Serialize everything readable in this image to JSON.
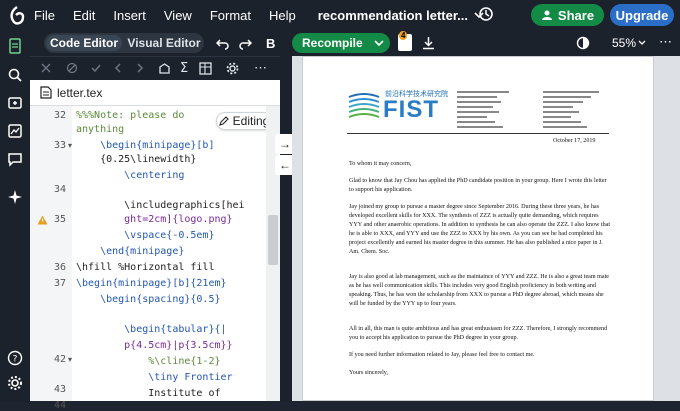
{
  "topbar": {
    "menu": [
      "File",
      "Edit",
      "Insert",
      "View",
      "Format",
      "Help"
    ],
    "title": "recommendation letter...",
    "share": "Share",
    "upgrade": "Upgrade"
  },
  "editor": {
    "code_editor": "Code Editor",
    "visual_editor": "Visual Editor",
    "file_name": "letter.tex",
    "editing": "Editing",
    "line_numbers": [
      "32",
      "",
      "33",
      "",
      "34",
      "35",
      "",
      "36",
      "37",
      "",
      "",
      "",
      "",
      "42",
      "",
      "43",
      "44"
    ],
    "lines": [
      "%%%Note: please do",
      "anything",
      "    \\begin{minipage}[b]",
      "    {0.25\\linewidth}",
      "        \\centering",
      "",
      "        \\includegraphics[hei",
      "        ght=2cm]{logo.png}",
      "        \\vspace{-0.5em}",
      "    \\end{minipage}",
      "\\hfill %Horizontal fill",
      "\\begin{minipage}[b]{21em}",
      "    \\begin{spacing}{0.5}",
      "",
      "        \\begin{tabular}{|",
      "        p{4.5cm}|p{3.5cm}}",
      "            %\\cline{1-2}",
      "            \\tiny Frontier",
      "            Institute of"
    ]
  },
  "preview": {
    "recompile": "Recompile",
    "zoom": "55%",
    "badge": "4",
    "logo_text": "FIST",
    "logo_cn": "前沿科学技术研究院",
    "date": "October 17, 2019",
    "salutation": "To whom it may concern,",
    "p1": "Glad to know that Jay Chou has applied the PhD candidate position in your group. Here I wrote this letter to support his application.",
    "p2": "Jay joined my group to pursue a master degree since September 2016. During these three years, he has developed excellent skills for XXX. The synthesis of ZZZ is actually quite demanding, which requires YYY and other anaerobic operations. In addition to synthesis he can also operate the ZZZ. I also know that he is able to XXX, and YYY and use the ZZZ to XXX by his own. As you can see he had completed his project excellently and earned his master degree in this summer. He has also published a nice paper in J. Am. Chem. Soc.",
    "p3": "Jay is also good at lab management, such as the maintaince of YYY and ZZZ. He is also a great team mate as he has well communication skills. This includes very good English proficiency in both writing and speaking. Thus, he has won the scholarship from XXX to pursue a PhD degree abroad, which means she will be funded by the YYY up to four years.",
    "p4": "All in all, this man is quite ambitious and has great enthusiasm for ZZZ. Therefore, I strongly recommend you to accept his application to pursue the PhD degree in your group.",
    "p5": "If you need further information related to Jay, please feel free to contact me.",
    "closing": "Yours sincerely,"
  },
  "colors": {
    "green": "#138a45",
    "blue": "#2b6ec8",
    "dark": "#1b222c"
  }
}
